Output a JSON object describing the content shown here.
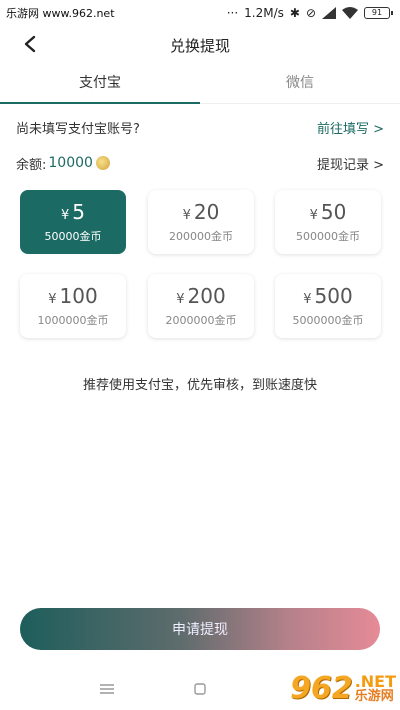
{
  "status_bar": {
    "watermark": "乐游网 www.962.net",
    "speed": "1.2M/s",
    "battery": "91"
  },
  "header": {
    "title": "兑换提现"
  },
  "tabs": [
    {
      "label": "支付宝",
      "active": true
    },
    {
      "label": "微信",
      "active": false
    }
  ],
  "account": {
    "prompt": "尚未填写支付宝账号?",
    "action": "前往填写 >"
  },
  "balance": {
    "label": "余额:",
    "value": "10000",
    "records_link": "提现记录 >"
  },
  "options": [
    {
      "amount": "5",
      "yen": "¥",
      "coins": "50000金币",
      "selected": true
    },
    {
      "amount": "20",
      "yen": "¥",
      "coins": "200000金币",
      "selected": false
    },
    {
      "amount": "50",
      "yen": "¥",
      "coins": "500000金币",
      "selected": false
    },
    {
      "amount": "100",
      "yen": "¥",
      "coins": "1000000金币",
      "selected": false
    },
    {
      "amount": "200",
      "yen": "¥",
      "coins": "2000000金币",
      "selected": false
    },
    {
      "amount": "500",
      "yen": "¥",
      "coins": "5000000金币",
      "selected": false
    }
  ],
  "hint": "推荐使用支付宝，优先审核，到账速度快",
  "submit_label": "申请提现",
  "corner_watermark": {
    "big": "962",
    "net": ".NET",
    "cn": "乐游网"
  },
  "colors": {
    "accent": "#1c6a64",
    "gradient_end": "#e58b97"
  }
}
